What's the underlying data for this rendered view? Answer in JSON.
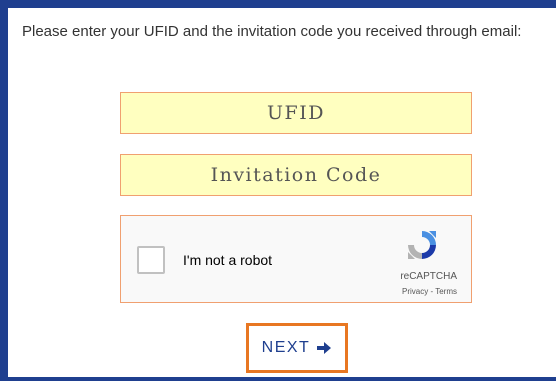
{
  "form": {
    "intro_text": "Please enter your UFID and the invitation code you received through email:",
    "ufid_placeholder": "UFID",
    "code_placeholder": "Invitation Code",
    "next_label": "NEXT"
  },
  "recaptcha": {
    "label": "I'm not a robot",
    "brand": "reCAPTCHA",
    "privacy": "Privacy",
    "terms": "Terms",
    "checked": false
  },
  "colors": {
    "frame": "#1f3f8f",
    "field_bg": "#ffffc0",
    "field_border": "#f0a070",
    "button_border": "#e87722",
    "button_text": "#1f3f8f"
  },
  "icons": {
    "next": "arrow-right-icon",
    "recaptcha": "recaptcha-logo-icon"
  }
}
